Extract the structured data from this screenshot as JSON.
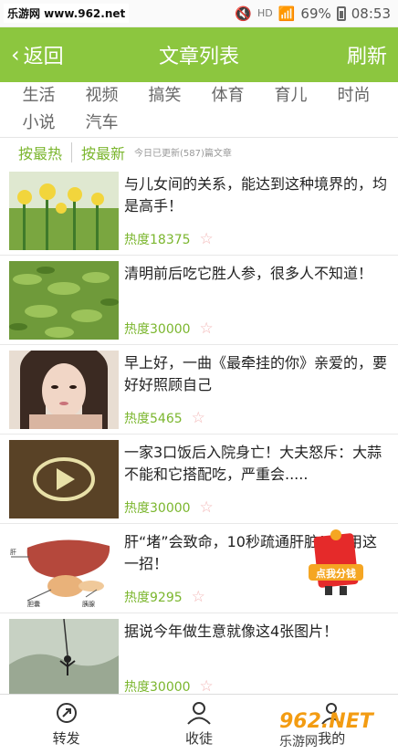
{
  "status_bar": {
    "watermark": "乐游网 www.962.net",
    "battery_percent": "69%",
    "time": "08:53",
    "hd": "HD"
  },
  "header": {
    "back_label": "返回",
    "title": "文章列表",
    "refresh_label": "刷新"
  },
  "categories": {
    "row1": [
      "生活",
      "视频",
      "搞笑",
      "体育",
      "育儿",
      "时尚"
    ],
    "row2": [
      "小说",
      "汽车"
    ]
  },
  "sort": {
    "hot_label": "按最热",
    "new_label": "按最新",
    "update_note": "今日已更新(587)篇文章"
  },
  "articles": [
    {
      "title": "与儿女间的关系，能达到这种境界的，均是高手！",
      "heat": "热度18375"
    },
    {
      "title": "清明前后吃它胜人参，很多人不知道！",
      "heat": "热度30000"
    },
    {
      "title": "早上好，一曲《最牵挂的你》亲爱的，要好好照顾自己",
      "heat": "热度5465"
    },
    {
      "title": "一家3口饭后入院身亡！大夫怒斥：大蒜不能和它搭配吃，严重会.....",
      "heat": "热度30000"
    },
    {
      "title": "肝“堵”会致命，10秒疏通肝脏！就用这一招！",
      "heat": "热度9295",
      "figure_labels": [
        "肝",
        "胆囊",
        "胰腺"
      ]
    },
    {
      "title": "据说今年做生意就像这4张图片！",
      "heat": "热度30000"
    }
  ],
  "floating_packet": {
    "label": "点我分钱"
  },
  "bottom_bar": {
    "share_label": "转发",
    "favorite_label": "收徒",
    "mine_label": "我的"
  },
  "brand_watermark": {
    "number": "962.NET",
    "text": "乐游网"
  },
  "colors": {
    "accent": "#8cc63f",
    "text_green": "#7bb62e",
    "star": "#f3b6b6",
    "packet": "#e52a2a"
  }
}
